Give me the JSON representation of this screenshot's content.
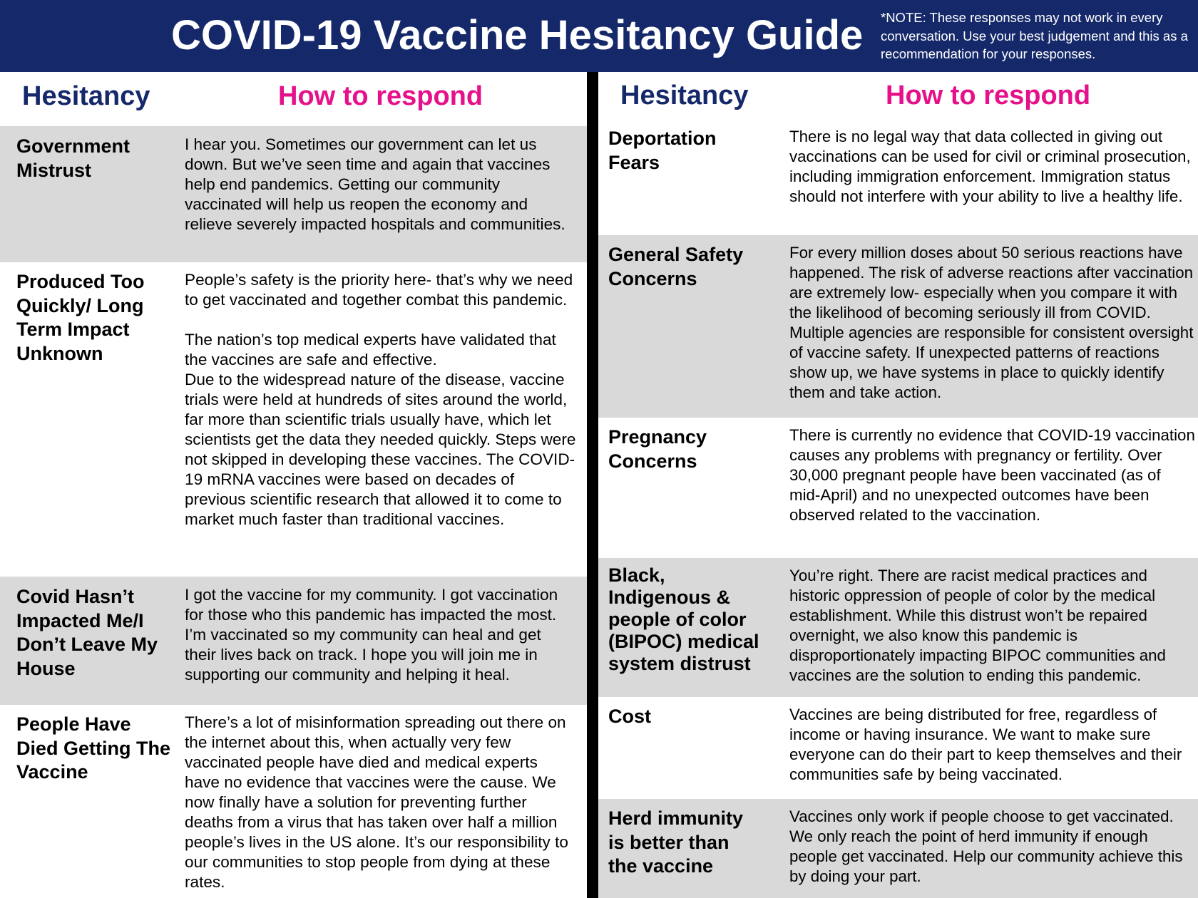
{
  "header": {
    "title": "COVID-19 Vaccine Hesitancy Guide",
    "note": "*NOTE: These responses may not work in every conversation. Use your best judgement and this as a recommendation for your responses.",
    "background_color": "#15296a"
  },
  "column_headers": {
    "hesitancy": "Hesitancy",
    "respond": "How to respond",
    "hesitancy_color": "#15296a",
    "respond_color": "#e6108a"
  },
  "left_rows": [
    {
      "hesitancy": "Government Mistrust",
      "response": [
        "I hear you. Sometimes our government can let us down. But we’ve seen time and again that vaccines help end pandemics. Getting our community vaccinated will help us reopen the economy and relieve severely impacted hospitals and communities."
      ]
    },
    {
      "hesitancy": "Produced Too Quickly/ Long Term Impact Unknown",
      "response": [
        "People’s safety is the priority here- that’s why we need to get vaccinated and together combat this pandemic.",
        "The nation’s top medical experts have validated that the vaccines are safe and effective.",
        "Due to the widespread nature of the disease, vaccine trials were held at hundreds of sites around the world, far more than scientific trials usually have, which let scientists get the data they needed quickly. Steps were not skipped in developing these vaccines. The COVID-19 mRNA vaccines were based on decades of previous scientific research that allowed it to come to market much faster than traditional vaccines."
      ]
    },
    {
      "hesitancy": "Covid Hasn’t Impacted Me/I Don’t Leave My House",
      "response": [
        "I got the vaccine for my community. I got vaccination for those who this pandemic has impacted the most. I’m vaccinated so my community can heal and get their lives back on track. I hope you will join me in supporting our community and helping it heal."
      ]
    },
    {
      "hesitancy": "People Have Died Getting The Vaccine",
      "response": [
        "There’s a lot of misinformation spreading out there on the internet about this, when actually very few vaccinated people have died and medical experts have no evidence that vaccines were the cause. We now finally have a solution for preventing further deaths from a virus that has taken over half a million people’s lives in the US alone. It’s our responsibility to our communities to stop people from dying at these rates."
      ]
    }
  ],
  "right_rows": [
    {
      "hesitancy": "Deportation Fears",
      "response": [
        "There is no legal way that data collected in giving out vaccinations can be used for civil or criminal prosecution, including immigration enforcement. Immigration status should not interfere with your ability to live a healthy life."
      ]
    },
    {
      "hesitancy": "General Safety Concerns",
      "response": [
        "For every million doses about 50 serious reactions have happened. The risk of adverse reactions after vaccination are extremely low- especially when you compare it with the likelihood of becoming seriously ill from COVID. Multiple agencies are responsible for consistent oversight of vaccine safety. If unexpected patterns of reactions show up, we have systems in place to quickly identify them and take action."
      ]
    },
    {
      "hesitancy": "Pregnancy Concerns",
      "response": [
        "There is currently no evidence that COVID-19 vaccination causes any problems with pregnancy or fertility. Over 30,000 pregnant people have been vaccinated (as of mid-April) and no unexpected outcomes have been observed related to the vaccination."
      ]
    },
    {
      "hesitancy": "Black, Indigenous & people of color (BIPOC) medical system distrust",
      "response": [
        "You’re right. There are racist medical practices and historic oppression of people of color by the medical establishment. While this distrust won’t be repaired overnight, we also know this pandemic is disproportionately impacting BIPOC communities and vaccines are the solution to ending this pandemic."
      ]
    },
    {
      "hesitancy": "Cost",
      "response": [
        "Vaccines are being distributed for free, regardless of income or having insurance. We want to make sure everyone can do their part to keep themselves and their communities safe by being vaccinated."
      ]
    },
    {
      "hesitancy": "Herd immunity is better than the vaccine",
      "response": [
        "Vaccines only work if people choose to get vaccinated. We only reach the point of herd immunity if enough people get vaccinated. Help our community achieve this by doing your part."
      ]
    }
  ]
}
